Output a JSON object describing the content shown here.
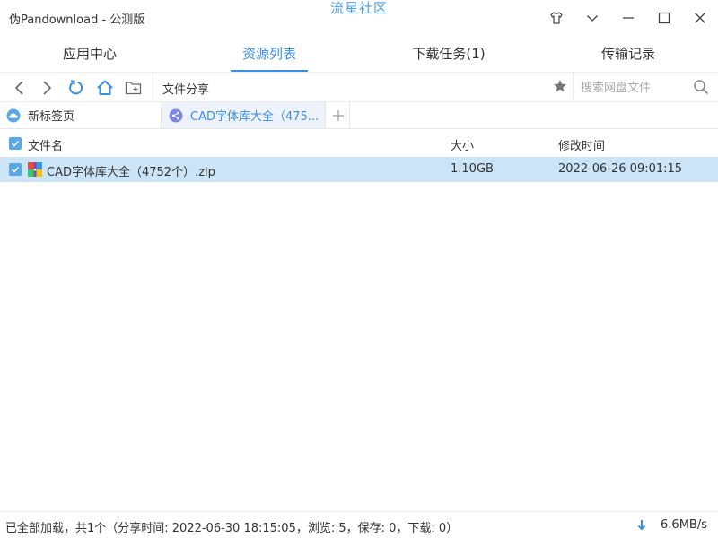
{
  "window": {
    "title": "伪Pandownload - 公测版",
    "brand": "流星社区"
  },
  "main_tabs": [
    {
      "label": "应用中心",
      "active": false
    },
    {
      "label": "资源列表",
      "active": true
    },
    {
      "label": "下载任务(1)",
      "active": false
    },
    {
      "label": "传输记录",
      "active": false
    }
  ],
  "toolbar": {
    "path": "文件分享",
    "search_placeholder": "搜索网盘文件",
    "search_value": ""
  },
  "tabs": [
    {
      "label": "新标签页",
      "icon": "cloud-icon"
    },
    {
      "label": "CAD字体库大全（475...",
      "icon": "share-icon",
      "active": true
    }
  ],
  "columns": {
    "name": "文件名",
    "size": "大小",
    "modified": "修改时间"
  },
  "files": [
    {
      "name": "CAD字体库大全（4752个）.zip",
      "size": "1.10GB",
      "modified": "2022-06-26 09:01:15",
      "checked": true,
      "icon": "zip-archive-icon"
    }
  ],
  "status": {
    "text": "已全部加载，共1个（分享时间: 2022-06-30 18:15:05，浏览: 5，保存: 0，下载: 0）",
    "speed": "6.6MB/s"
  },
  "colors": {
    "accent": "#3a8ee6",
    "brand": "#4aa0e6",
    "selected_row": "#cce4f7",
    "checkbox": "#5aa8ea"
  }
}
